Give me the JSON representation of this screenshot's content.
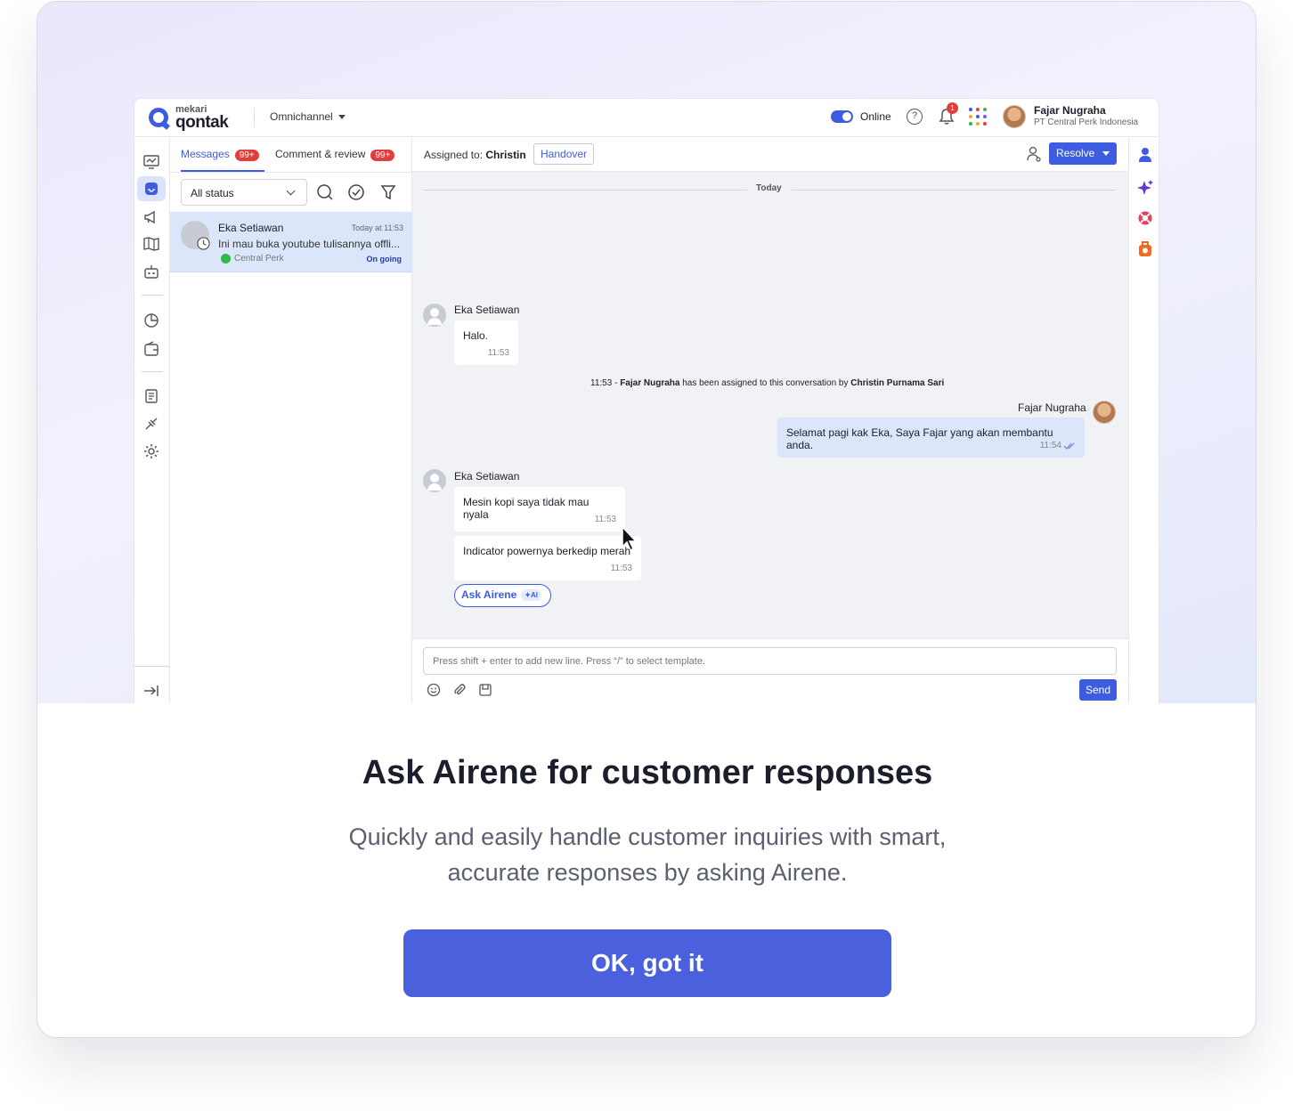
{
  "app": {
    "brand_top": "mekari",
    "brand_name": "qontak",
    "product_menu": "Omnichannel",
    "status_label": "Online",
    "notification_count": "1",
    "user_name": "Fajar Nugraha",
    "user_org": "PT Central Perk Indonesia"
  },
  "list": {
    "tabs": [
      {
        "label": "Messages",
        "badge": "99+"
      },
      {
        "label": "Comment & review",
        "badge": "99+"
      }
    ],
    "status_filter": "All status",
    "conversations": [
      {
        "name": "Eka Setiawan",
        "time": "Today at 11:53",
        "preview": "Ini mau buka youtube tulisannya offli...",
        "channel": "Central Perk",
        "status": "On going"
      }
    ]
  },
  "chat": {
    "assigned_prefix": "Assigned to:",
    "assigned_to": "Christin",
    "handover_label": "Handover",
    "resolve_label": "Resolve",
    "day_divider": "Today",
    "messages": [
      {
        "sender": "Eka Setiawan",
        "text": "Halo.",
        "time": "11:53"
      },
      {
        "sender": "Fajar Nugraha",
        "text": "Selamat pagi kak Eka, Saya Fajar yang akan membantu anda.",
        "time": "11:54"
      },
      {
        "sender": "Eka Setiawan",
        "text": "Mesin kopi saya tidak mau nyala",
        "time": "11:53"
      },
      {
        "sender": "Eka Setiawan",
        "text": "Indicator powernya berkedip merah",
        "time": "11:53"
      }
    ],
    "system_message": {
      "time": "11:53",
      "separator": "-",
      "agent": "Fajar Nugraha",
      "middle": "has been assigned to this conversation by",
      "assigner": "Christin Purnama Sari"
    },
    "ask_airene_label": "Ask Airene",
    "ai_tag": "AI",
    "composer_placeholder": "Press shift + enter to add new line. Press “/” to select template.",
    "send_label": "Send"
  },
  "onboarding": {
    "title": "Ask Airene for customer responses",
    "description_line1": "Quickly and easily handle customer inquiries with smart,",
    "description_line2": "accurate responses by asking Airene.",
    "cta_label": "OK, got it"
  },
  "colors": {
    "accent": "#3d5ce0",
    "cta": "#4a60dd",
    "badge": "#e23d3d",
    "selected_row": "#dbe6fb",
    "chat_bg": "#f0f2f6"
  }
}
